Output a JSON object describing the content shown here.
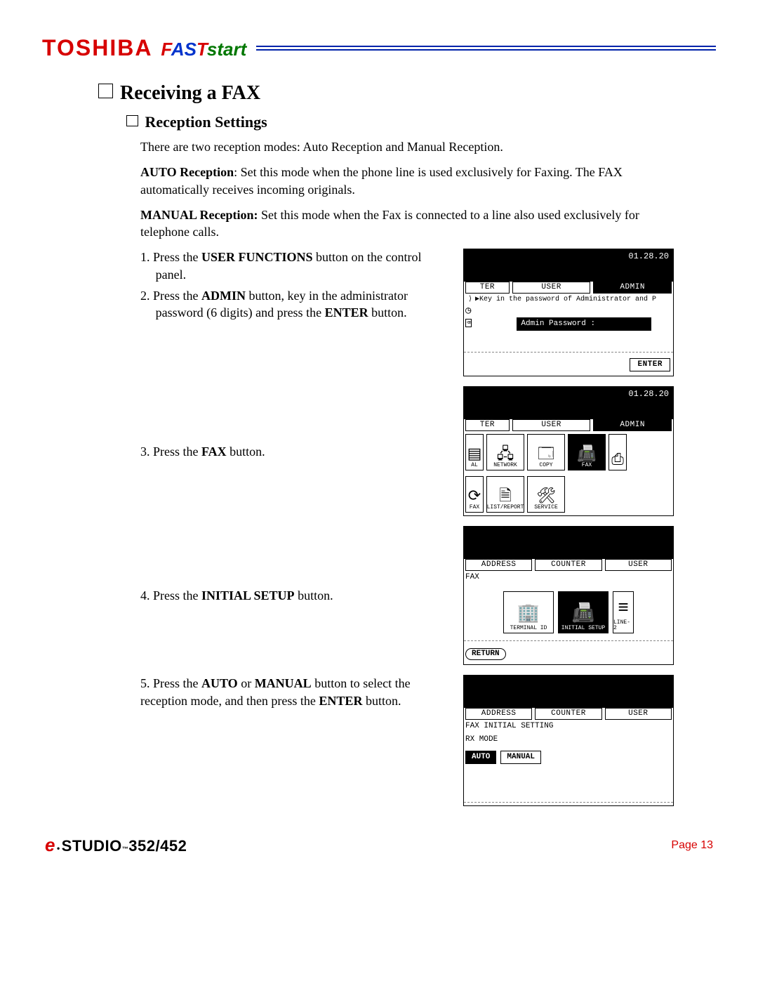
{
  "header": {
    "brand": "TOSHIBA",
    "faststart": {
      "f": "F",
      "a": "A",
      "s": "S",
      "t": "T",
      "rest": "start"
    }
  },
  "h1": "Receiving a FAX",
  "h2": "Reception Settings",
  "para_intro": "There are two reception modes: Auto Reception and Manual Reception.",
  "para_auto_label": "AUTO Reception",
  "para_auto_text": ": Set this mode when the phone line is used exclusively for Faxing. The FAX automatically receives incoming originals.",
  "para_manual_label": "MANUAL Reception:",
  "para_manual_text": " Set this mode when the Fax is connected to a line also used exclusively for telephone calls.",
  "steps": {
    "s1a_pre": "1. Press the ",
    "s1a_b": "USER FUNCTIONS",
    "s1a_post": " button on the control panel.",
    "s2a_pre": "2. Press the ",
    "s2a_b": "ADMIN",
    "s2a_mid": " button, key in the administrator password (6 digits) and press the ",
    "s2a_b2": "ENTER",
    "s2a_post": " button.",
    "s3_pre": "3. Press the ",
    "s3_b": "FAX",
    "s3_post": " button.",
    "s4_pre": "4. Press the ",
    "s4_b": "INITIAL SETUP",
    "s4_post": " button.",
    "s5_pre": "5. Press the ",
    "s5_b1": "AUTO",
    "s5_mid1": " or ",
    "s5_b2": "MANUAL",
    "s5_mid2": " button to select the reception mode, and then press the ",
    "s5_b3": "ENTER",
    "s5_post": " button."
  },
  "screen1": {
    "date": "01.28.20",
    "tabs": [
      "TER",
      "USER",
      "ADMIN"
    ],
    "prompt": "▶Key in the password of Administrator and P",
    "pw_label": "Admin Password  :",
    "enter": "ENTER"
  },
  "screen2": {
    "date": "01.28.20",
    "tabs": [
      "TER",
      "USER",
      "ADMIN"
    ],
    "icons_row1": [
      "AL",
      "NETWORK",
      "COPY",
      "FAX",
      ""
    ],
    "icons_row2": [
      "FAX",
      "LIST/REPORT",
      "SERVICE"
    ]
  },
  "screen3": {
    "tabs": [
      "ADDRESS",
      "COUNTER",
      "USER"
    ],
    "crumb": "FAX",
    "icons": [
      "TERMINAL ID",
      "INITIAL SETUP",
      "LINE-2"
    ],
    "return": "RETURN"
  },
  "screen4": {
    "tabs": [
      "ADDRESS",
      "COUNTER",
      "USER"
    ],
    "crumb": "FAX INITIAL SETTING",
    "label": "RX MODE",
    "buttons": [
      "AUTO",
      "MANUAL"
    ]
  },
  "footer": {
    "e": "e",
    "studio": "STUDIO",
    "model": "352/452",
    "page_label": "Page 13"
  }
}
